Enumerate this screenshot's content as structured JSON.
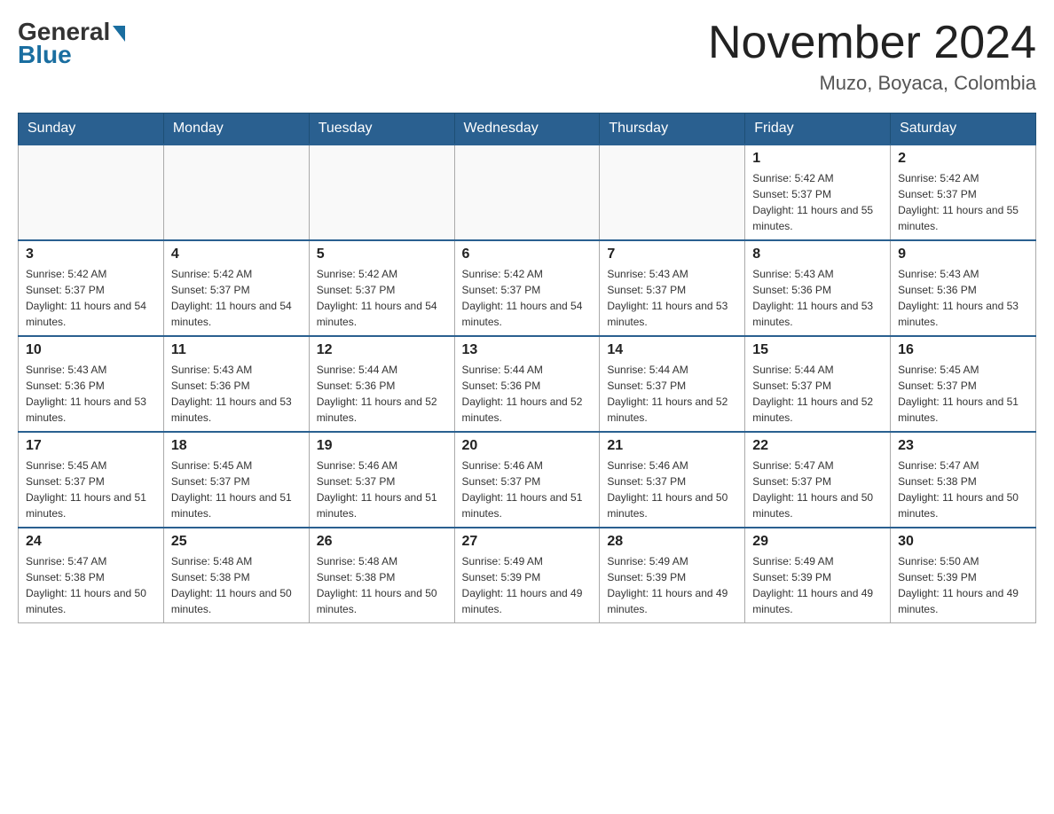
{
  "header": {
    "logo_text_general": "General",
    "logo_text_blue": "Blue",
    "calendar_title": "November 2024",
    "calendar_subtitle": "Muzo, Boyaca, Colombia"
  },
  "weekdays": [
    "Sunday",
    "Monday",
    "Tuesday",
    "Wednesday",
    "Thursday",
    "Friday",
    "Saturday"
  ],
  "weeks": [
    [
      {
        "day": "",
        "sunrise": "",
        "sunset": "",
        "daylight": ""
      },
      {
        "day": "",
        "sunrise": "",
        "sunset": "",
        "daylight": ""
      },
      {
        "day": "",
        "sunrise": "",
        "sunset": "",
        "daylight": ""
      },
      {
        "day": "",
        "sunrise": "",
        "sunset": "",
        "daylight": ""
      },
      {
        "day": "",
        "sunrise": "",
        "sunset": "",
        "daylight": ""
      },
      {
        "day": "1",
        "sunrise": "Sunrise: 5:42 AM",
        "sunset": "Sunset: 5:37 PM",
        "daylight": "Daylight: 11 hours and 55 minutes."
      },
      {
        "day": "2",
        "sunrise": "Sunrise: 5:42 AM",
        "sunset": "Sunset: 5:37 PM",
        "daylight": "Daylight: 11 hours and 55 minutes."
      }
    ],
    [
      {
        "day": "3",
        "sunrise": "Sunrise: 5:42 AM",
        "sunset": "Sunset: 5:37 PM",
        "daylight": "Daylight: 11 hours and 54 minutes."
      },
      {
        "day": "4",
        "sunrise": "Sunrise: 5:42 AM",
        "sunset": "Sunset: 5:37 PM",
        "daylight": "Daylight: 11 hours and 54 minutes."
      },
      {
        "day": "5",
        "sunrise": "Sunrise: 5:42 AM",
        "sunset": "Sunset: 5:37 PM",
        "daylight": "Daylight: 11 hours and 54 minutes."
      },
      {
        "day": "6",
        "sunrise": "Sunrise: 5:42 AM",
        "sunset": "Sunset: 5:37 PM",
        "daylight": "Daylight: 11 hours and 54 minutes."
      },
      {
        "day": "7",
        "sunrise": "Sunrise: 5:43 AM",
        "sunset": "Sunset: 5:37 PM",
        "daylight": "Daylight: 11 hours and 53 minutes."
      },
      {
        "day": "8",
        "sunrise": "Sunrise: 5:43 AM",
        "sunset": "Sunset: 5:36 PM",
        "daylight": "Daylight: 11 hours and 53 minutes."
      },
      {
        "day": "9",
        "sunrise": "Sunrise: 5:43 AM",
        "sunset": "Sunset: 5:36 PM",
        "daylight": "Daylight: 11 hours and 53 minutes."
      }
    ],
    [
      {
        "day": "10",
        "sunrise": "Sunrise: 5:43 AM",
        "sunset": "Sunset: 5:36 PM",
        "daylight": "Daylight: 11 hours and 53 minutes."
      },
      {
        "day": "11",
        "sunrise": "Sunrise: 5:43 AM",
        "sunset": "Sunset: 5:36 PM",
        "daylight": "Daylight: 11 hours and 53 minutes."
      },
      {
        "day": "12",
        "sunrise": "Sunrise: 5:44 AM",
        "sunset": "Sunset: 5:36 PM",
        "daylight": "Daylight: 11 hours and 52 minutes."
      },
      {
        "day": "13",
        "sunrise": "Sunrise: 5:44 AM",
        "sunset": "Sunset: 5:36 PM",
        "daylight": "Daylight: 11 hours and 52 minutes."
      },
      {
        "day": "14",
        "sunrise": "Sunrise: 5:44 AM",
        "sunset": "Sunset: 5:37 PM",
        "daylight": "Daylight: 11 hours and 52 minutes."
      },
      {
        "day": "15",
        "sunrise": "Sunrise: 5:44 AM",
        "sunset": "Sunset: 5:37 PM",
        "daylight": "Daylight: 11 hours and 52 minutes."
      },
      {
        "day": "16",
        "sunrise": "Sunrise: 5:45 AM",
        "sunset": "Sunset: 5:37 PM",
        "daylight": "Daylight: 11 hours and 51 minutes."
      }
    ],
    [
      {
        "day": "17",
        "sunrise": "Sunrise: 5:45 AM",
        "sunset": "Sunset: 5:37 PM",
        "daylight": "Daylight: 11 hours and 51 minutes."
      },
      {
        "day": "18",
        "sunrise": "Sunrise: 5:45 AM",
        "sunset": "Sunset: 5:37 PM",
        "daylight": "Daylight: 11 hours and 51 minutes."
      },
      {
        "day": "19",
        "sunrise": "Sunrise: 5:46 AM",
        "sunset": "Sunset: 5:37 PM",
        "daylight": "Daylight: 11 hours and 51 minutes."
      },
      {
        "day": "20",
        "sunrise": "Sunrise: 5:46 AM",
        "sunset": "Sunset: 5:37 PM",
        "daylight": "Daylight: 11 hours and 51 minutes."
      },
      {
        "day": "21",
        "sunrise": "Sunrise: 5:46 AM",
        "sunset": "Sunset: 5:37 PM",
        "daylight": "Daylight: 11 hours and 50 minutes."
      },
      {
        "day": "22",
        "sunrise": "Sunrise: 5:47 AM",
        "sunset": "Sunset: 5:37 PM",
        "daylight": "Daylight: 11 hours and 50 minutes."
      },
      {
        "day": "23",
        "sunrise": "Sunrise: 5:47 AM",
        "sunset": "Sunset: 5:38 PM",
        "daylight": "Daylight: 11 hours and 50 minutes."
      }
    ],
    [
      {
        "day": "24",
        "sunrise": "Sunrise: 5:47 AM",
        "sunset": "Sunset: 5:38 PM",
        "daylight": "Daylight: 11 hours and 50 minutes."
      },
      {
        "day": "25",
        "sunrise": "Sunrise: 5:48 AM",
        "sunset": "Sunset: 5:38 PM",
        "daylight": "Daylight: 11 hours and 50 minutes."
      },
      {
        "day": "26",
        "sunrise": "Sunrise: 5:48 AM",
        "sunset": "Sunset: 5:38 PM",
        "daylight": "Daylight: 11 hours and 50 minutes."
      },
      {
        "day": "27",
        "sunrise": "Sunrise: 5:49 AM",
        "sunset": "Sunset: 5:39 PM",
        "daylight": "Daylight: 11 hours and 49 minutes."
      },
      {
        "day": "28",
        "sunrise": "Sunrise: 5:49 AM",
        "sunset": "Sunset: 5:39 PM",
        "daylight": "Daylight: 11 hours and 49 minutes."
      },
      {
        "day": "29",
        "sunrise": "Sunrise: 5:49 AM",
        "sunset": "Sunset: 5:39 PM",
        "daylight": "Daylight: 11 hours and 49 minutes."
      },
      {
        "day": "30",
        "sunrise": "Sunrise: 5:50 AM",
        "sunset": "Sunset: 5:39 PM",
        "daylight": "Daylight: 11 hours and 49 minutes."
      }
    ]
  ]
}
